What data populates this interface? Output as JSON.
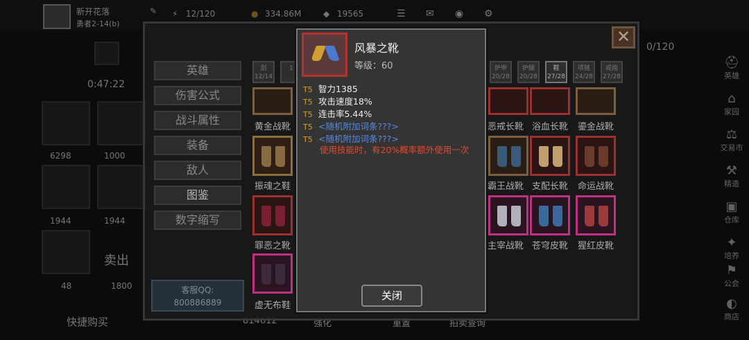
{
  "hud": {
    "player_name": "新开花落",
    "player_sub": "勇者2-14(b)",
    "energy": "12/120",
    "gold": "334.86M",
    "gems": "19565",
    "timer": "0:47:22",
    "capacity": "0/120",
    "left_values": [
      "6298",
      "1000",
      "1944",
      "1944",
      "48",
      "1800"
    ],
    "bottom_left": "快捷购买",
    "bottom_labels": [
      "814612",
      "强化",
      "重置",
      "拍卖查询"
    ],
    "sell": "卖出"
  },
  "menu": {
    "items": [
      "英雄",
      "伤害公式",
      "战斗属性",
      "装备",
      "敌人",
      "图鉴",
      "数字缩写"
    ],
    "active_index": 5,
    "service_label": "客服QQ:",
    "service_number": "800886889"
  },
  "tabs": [
    {
      "name": "剑",
      "count": "12/14"
    },
    {
      "name": "",
      "count": "1"
    },
    {
      "name": "护甲",
      "count": "20/28"
    },
    {
      "name": "护腿",
      "count": "20/28"
    },
    {
      "name": "鞋",
      "count": "27/28"
    },
    {
      "name": "项链",
      "count": "24/28"
    },
    {
      "name": "戒指",
      "count": "27/28"
    }
  ],
  "grid": {
    "left_col": [
      "黄金战靴",
      "振魂之鞋",
      "罪恶之靴",
      "虚无布鞋"
    ],
    "right_rows": [
      [
        "恶戒长靴",
        "浴血长靴",
        "鎏金战靴"
      ],
      [
        "霸王战靴",
        "支配长靴",
        "命运战靴"
      ],
      [
        "主宰战靴",
        "苍穹皮靴",
        "猩红皮靴"
      ]
    ]
  },
  "popup": {
    "title": "风暴之靴",
    "level": "等级：60",
    "stats": [
      {
        "tier": "T5",
        "text": "智力1385",
        "style": "normal"
      },
      {
        "tier": "T5",
        "text": "攻击速度18%",
        "style": "normal"
      },
      {
        "tier": "T5",
        "text": "连击率5.44%",
        "style": "normal"
      },
      {
        "tier": "T5",
        "text": "<随机附加词条???>",
        "style": "blue"
      },
      {
        "tier": "T5",
        "text": "<随机附加词条???>",
        "style": "blue"
      }
    ],
    "effect": "使用技能时，有20%概率额外使用一次",
    "close_label": "关闭"
  },
  "rail": [
    "英雄",
    "家园",
    "交易市",
    "精造",
    "仓库",
    "培养",
    "公会",
    "商店"
  ],
  "colors": {
    "popup_bg": "#343434",
    "tier_gold": "#d8a020",
    "effect_red": "#e04a30",
    "affix_blue": "#5a8ad8"
  }
}
